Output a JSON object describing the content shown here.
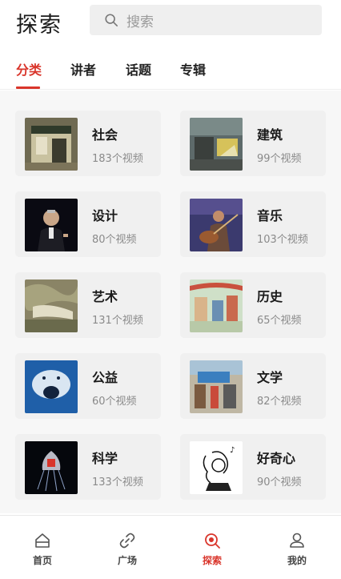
{
  "header": {
    "title": "探索",
    "search_placeholder": "搜索"
  },
  "tabs": [
    {
      "label": "分类",
      "active": true
    },
    {
      "label": "讲者",
      "active": false
    },
    {
      "label": "话题",
      "active": false
    },
    {
      "label": "专辑",
      "active": false
    }
  ],
  "categories": [
    {
      "name": "社会",
      "count": "183个视频",
      "icon": "society-thumbnail"
    },
    {
      "name": "建筑",
      "count": "99个视频",
      "icon": "architecture-thumbnail"
    },
    {
      "name": "设计",
      "count": "80个视频",
      "icon": "design-thumbnail"
    },
    {
      "name": "音乐",
      "count": "103个视频",
      "icon": "music-thumbnail"
    },
    {
      "name": "艺术",
      "count": "131个视频",
      "icon": "art-thumbnail"
    },
    {
      "name": "历史",
      "count": "65个视频",
      "icon": "history-thumbnail"
    },
    {
      "name": "公益",
      "count": "60个视频",
      "icon": "charity-thumbnail"
    },
    {
      "name": "文学",
      "count": "82个视频",
      "icon": "literature-thumbnail"
    },
    {
      "name": "科学",
      "count": "133个视频",
      "icon": "science-thumbnail"
    },
    {
      "name": "好奇心",
      "count": "90个视频",
      "icon": "curiosity-thumbnail"
    }
  ],
  "bottom_nav": [
    {
      "label": "首页",
      "icon": "home-icon",
      "active": false
    },
    {
      "label": "广场",
      "icon": "link-icon",
      "active": false
    },
    {
      "label": "探索",
      "icon": "explore-search-icon",
      "active": true
    },
    {
      "label": "我的",
      "icon": "profile-icon",
      "active": false
    }
  ],
  "colors": {
    "accent": "#d9352b",
    "card_bg": "#f0f0f0",
    "content_bg": "#f7f7f7"
  }
}
